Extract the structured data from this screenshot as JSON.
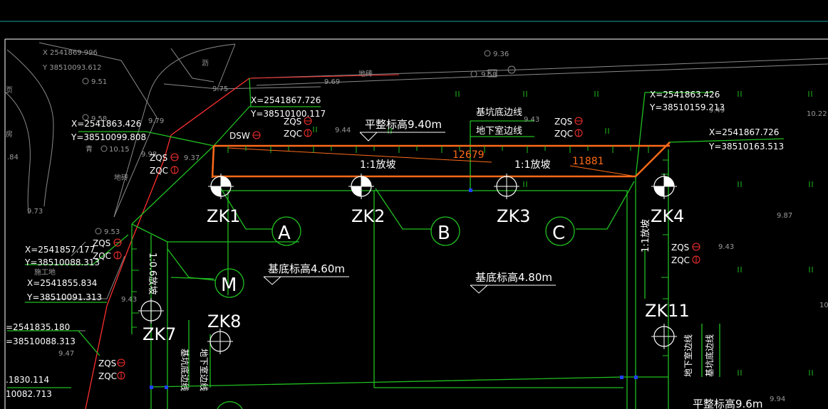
{
  "colors": {
    "background": "#000000",
    "green": "#20c020",
    "white": "#ffffff",
    "grey": "#8a8a8a",
    "orange": "#ff6a1a",
    "red": "#ff3030",
    "blue": "#2040ff"
  },
  "coords": {
    "c1x": "X 2541869.996",
    "c1y": "Y 38510093.612",
    "c2x": "X=2541867.726",
    "c2y": "Y=38510100.117",
    "c3x": "X=2541863.426",
    "c3y": "Y=38510099.808",
    "c4x": "X=2541863.426",
    "c4y": "Y=38510159.213",
    "c5x": "X=2541867.726",
    "c5y": "Y=38510163.513",
    "c6x": "X=2541857.177",
    "c6y": "Y=38510088.313",
    "c7x": "X=2541855.834",
    "c7y": "Y=38510091.313",
    "c8x": "=2541835.180",
    "c8y": "=38510088.313",
    "c9x": ".1830.114",
    "c9y": "10082.713"
  },
  "elevations": {
    "e_951": "9.51",
    "e_936": "9.36",
    "e_958top": "9.58",
    "e_975": "9.75",
    "e_969": "9.69",
    "e_958": "9.58",
    "e_979": "9.79",
    "e_1015": "10.15",
    "e_998": "9.98",
    "e_937": "9.37",
    "e_944": "9.44",
    "e_943a": "9.43",
    "e_949": "9.49",
    "e_1022": "10.22",
    "e_973": "9.73",
    "e_953": "9.53",
    "e_987": "9.87",
    "e_943b": "9.43",
    "e_943c": "9.43",
    "e_947": "9.47",
    "e_994": "9.94",
    "e_10": "10",
    "e_84": ".84"
  },
  "labels": {
    "dsw": "DSW",
    "zqs": "ZQS",
    "zqc": "ZQC",
    "grade_level": "平整标高9.40m",
    "pit_edge": "基坑底边线",
    "basement_edge": "地下室边线",
    "slope": "1:1放坡",
    "slope_v": "1:0.6放坡",
    "base_level_1": "基底标高4.60m",
    "base_level_2": "基底标高4.80m",
    "grade_level_bottom": "平整标高9.6m",
    "ground": "地砖",
    "construction": "施工地",
    "dim1": "12679",
    "dim2": "11881",
    "edge_char_1": "沥",
    "edge_char_2": "页",
    "edge_char_3": "砖",
    "edge_char_4": "青",
    "edge_char_5": "地砖",
    "edge_char_6": "房"
  },
  "boreholes": [
    "ZK1",
    "ZK2",
    "ZK3",
    "ZK4",
    "ZK7",
    "ZK8",
    "ZK11"
  ],
  "axes": [
    "A",
    "B",
    "C",
    "M"
  ]
}
